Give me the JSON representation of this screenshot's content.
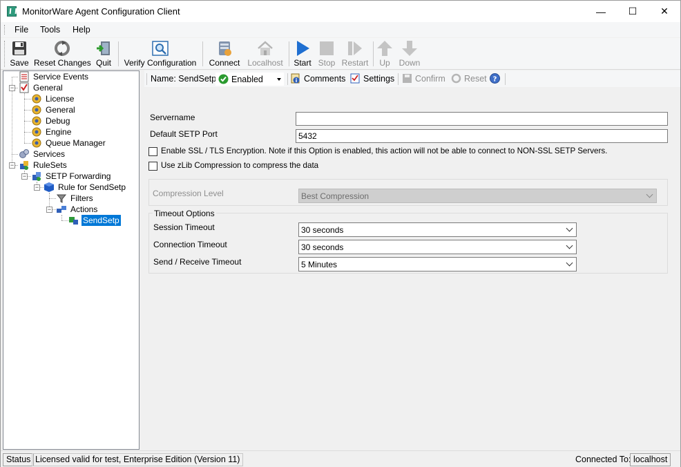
{
  "window": {
    "title": "MonitorWare Agent Configuration Client",
    "min_glyph": "—",
    "max_glyph": "☐",
    "close_glyph": "✕"
  },
  "menu": [
    "File",
    "Tools",
    "Help"
  ],
  "toolbar": {
    "save": "Save",
    "reset_changes": "Reset Changes",
    "quit": "Quit",
    "verify_configuration": "Verify Configuration",
    "connect": "Connect",
    "localhost": "Localhost",
    "start": "Start",
    "stop": "Stop",
    "restart": "Restart",
    "up": "Up",
    "down": "Down"
  },
  "tree": {
    "service_events": "Service Events",
    "general": "General",
    "license": "License",
    "general_child": "General",
    "debug": "Debug",
    "engine": "Engine",
    "queue_manager": "Queue Manager",
    "services": "Services",
    "rulesets": "RuleSets",
    "setp_forwarding": "SETP Forwarding",
    "rule_for_sendsetp": "Rule for SendSetp",
    "filters": "Filters",
    "actions": "Actions",
    "sendsetp": "SendSetp"
  },
  "action_bar": {
    "name_label": "Name: SendSetp",
    "state": "Enabled",
    "comments": "Comments",
    "settings": "Settings",
    "confirm": "Confirm",
    "reset": "Reset"
  },
  "form": {
    "servername_label": "Servername",
    "servername_value": "",
    "port_label": "Default SETP Port",
    "port_value": "5432",
    "ssl_label": "Enable SSL / TLS Encryption. Note if this Option is enabled, this action will not be able to connect to NON-SSL SETP Servers.",
    "ssl_checked": false,
    "zlib_label": "Use zLib Compression to compress the data",
    "zlib_checked": false,
    "compression_label": "Compression Level",
    "compression_value": "Best Compression",
    "timeout_group": "Timeout Options",
    "session_timeout_label": "Session Timeout",
    "session_timeout_value": "30 seconds",
    "connection_timeout_label": "Connection Timeout",
    "connection_timeout_value": "30 seconds",
    "sendrecv_timeout_label": "Send / Receive Timeout",
    "sendrecv_timeout_value": "5 Minutes"
  },
  "status": {
    "status": "Status",
    "license": "Licensed valid for test, Enterprise Edition (Version 11)",
    "connected_to_label": "Connected To:",
    "connected_to_value": "localhost"
  }
}
